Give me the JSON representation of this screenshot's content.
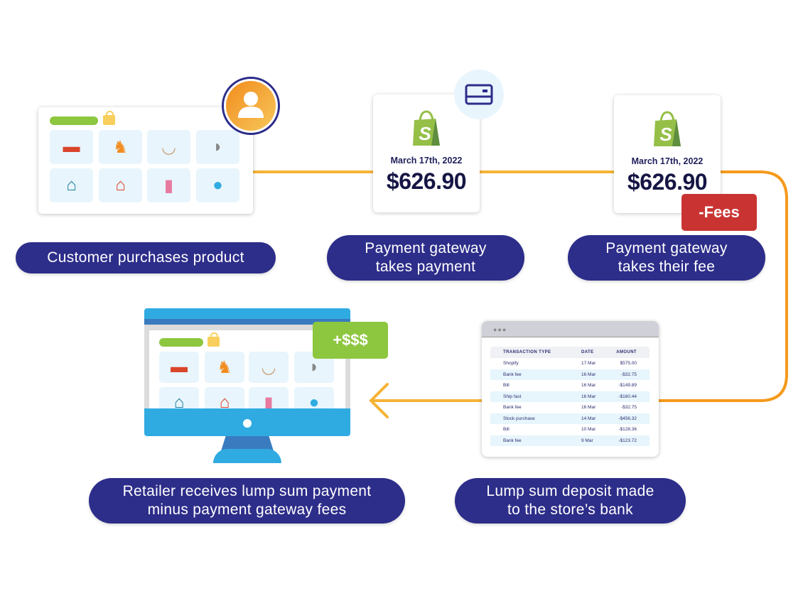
{
  "colors": {
    "navy": "#2d2d8a",
    "flow_line": "#f5b335",
    "flow_line_orange": "#f59a1c",
    "shopify_green": "#95bf47",
    "fee_red": "#c93432",
    "gain_green": "#8dc63f",
    "monitor_blue": "#30abe2"
  },
  "steps": {
    "customer": {
      "label": "Customer purchases product",
      "icon": "user-avatar-icon"
    },
    "gateway": {
      "label_line1": "Payment gateway",
      "label_line2": "takes payment",
      "icon": "credit-card-icon"
    },
    "fee": {
      "label_line1": "Payment gateway",
      "label_line2": "takes their fee"
    },
    "deposit": {
      "label_line1": "Lump sum deposit made",
      "label_line2": "to the store’s bank"
    },
    "retailer": {
      "label_line1": "Retailer receives lump sum payment",
      "label_line2": "minus payment gateway fees"
    }
  },
  "payment_cards": [
    {
      "date": "March 17th, 2022",
      "amount": "$626.90",
      "logo": "shopify-bag-icon"
    },
    {
      "date": "March 17th, 2022",
      "amount": "$626.90",
      "logo": "shopify-bag-icon"
    }
  ],
  "badges": {
    "fees": "-Fees",
    "gain": "+$$$"
  },
  "store_products": [
    "dog-collar",
    "rocking-horse",
    "pet-bowl",
    "cap",
    "cuckoo-clock",
    "dog-house",
    "water-bottle",
    "watch"
  ],
  "bank": {
    "window_dots": "●●●",
    "columns": [
      "TRANSACTION TYPE",
      "DATE",
      "AMOUNT"
    ],
    "rows": [
      [
        "Shopify",
        "17 Mar",
        "$575.00"
      ],
      [
        "Bank fee",
        "16 Mar",
        "-$32.75"
      ],
      [
        "Bill",
        "16 Mar",
        "-$149.89"
      ],
      [
        "Ship fast",
        "16 Mar",
        "-$160.44"
      ],
      [
        "Bank fee",
        "16 Mar",
        "-$32.75"
      ],
      [
        "Stock purchase",
        "14 Mar",
        "-$456.32"
      ],
      [
        "Bill",
        "10 Mar",
        "-$128.36"
      ],
      [
        "Bank fee",
        "9 Mar",
        "-$123.72"
      ]
    ]
  }
}
